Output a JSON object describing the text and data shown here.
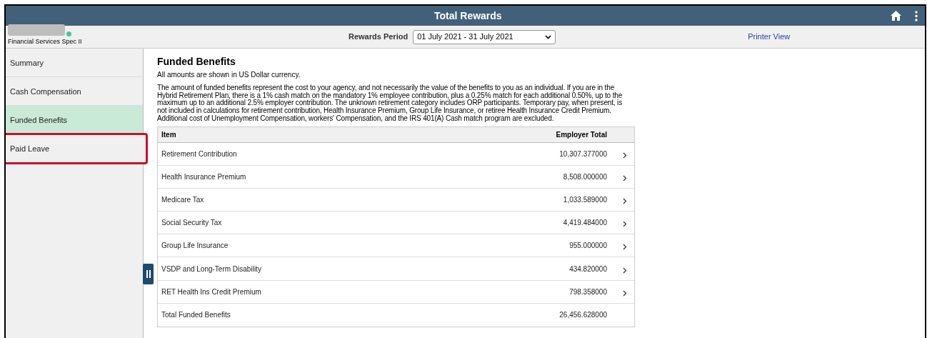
{
  "header": {
    "title": "Total Rewards"
  },
  "employee": {
    "job_title": "Financial Services Spec II"
  },
  "rewards_period": {
    "label": "Rewards Period",
    "value": "01 July 2021 - 31 July 2021"
  },
  "printer_view": "Printer View",
  "sidebar": {
    "items": [
      {
        "label": "Summary",
        "selected": false,
        "highlighted": false
      },
      {
        "label": "Cash Compensation",
        "selected": false,
        "highlighted": false
      },
      {
        "label": "Funded Benefits",
        "selected": true,
        "highlighted": false
      },
      {
        "label": "Paid Leave",
        "selected": false,
        "highlighted": true
      }
    ]
  },
  "content": {
    "title": "Funded Benefits",
    "currency_note": "All amounts are shown in US Dollar currency.",
    "description": "The amount of funded benefits represent the cost to your agency, and not necessarily the value of the benefits to you as an individual. If you are in the Hybrid Retirement Plan, there is a 1% cash match on the mandatory 1% employee contribution, plus a 0.25% match for each additional 0.50%, up to the maximum up to an additional 2.5% employer contribution.  The unknown retirement category includes ORP participants. Temporary pay, when present, is not included in calculations for retirement contribution, Health Insurance Premium, Group Life Insurance, or retiree Health Insurance Credit Premium. Additional cost of Unemployment Compensation, workers' Compensation, and the IRS 401(A) Cash match program are excluded."
  },
  "table": {
    "columns": [
      "Item",
      "Employer Total"
    ],
    "rows": [
      {
        "item": "Retirement Contribution",
        "total": "10,307.377000",
        "kind": "link"
      },
      {
        "item": "Health Insurance Premium",
        "total": "8,508.000000",
        "kind": "link"
      },
      {
        "item": "Medicare Tax",
        "total": "1,033.589000",
        "kind": "link"
      },
      {
        "item": "Social Security Tax",
        "total": "4,419.484000",
        "kind": "link"
      },
      {
        "item": "Group Life Insurance",
        "total": "955.000000",
        "kind": "link"
      },
      {
        "item": "VSDP and Long-Term Disability",
        "total": "434.820000",
        "kind": "link"
      },
      {
        "item": "RET Health Ins Credit Premium",
        "total": "798.358000",
        "kind": "link"
      },
      {
        "item": "Total Funded Benefits",
        "total": "26,456.628000",
        "kind": "total"
      }
    ]
  }
}
